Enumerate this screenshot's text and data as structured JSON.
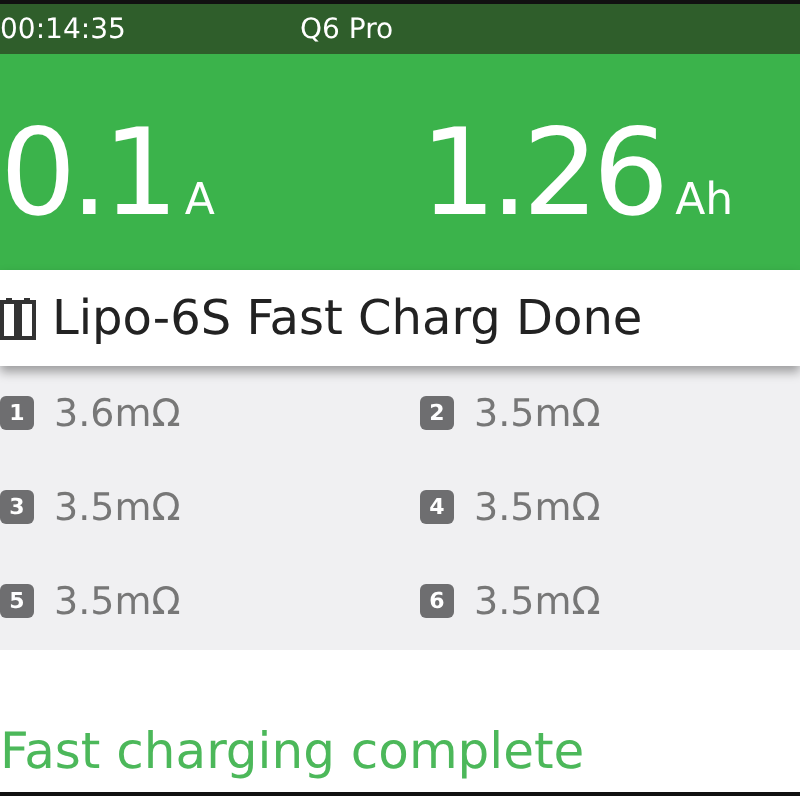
{
  "status_bar": {
    "time": "00:14:35",
    "title": "Q6 Pro"
  },
  "readings": [
    {
      "value": "0.1",
      "unit": "A"
    },
    {
      "value": "1.26",
      "unit": "Ah"
    }
  ],
  "status": {
    "text": "Lipo-6S Fast Charg Done"
  },
  "cells": [
    {
      "index": "1",
      "resistance": "3.6mΩ"
    },
    {
      "index": "2",
      "resistance": "3.5mΩ"
    },
    {
      "index": "3",
      "resistance": "3.5mΩ"
    },
    {
      "index": "4",
      "resistance": "3.5mΩ"
    },
    {
      "index": "5",
      "resistance": "3.5mΩ"
    },
    {
      "index": "6",
      "resistance": "3.5mΩ"
    }
  ],
  "message": "Fast charging complete"
}
